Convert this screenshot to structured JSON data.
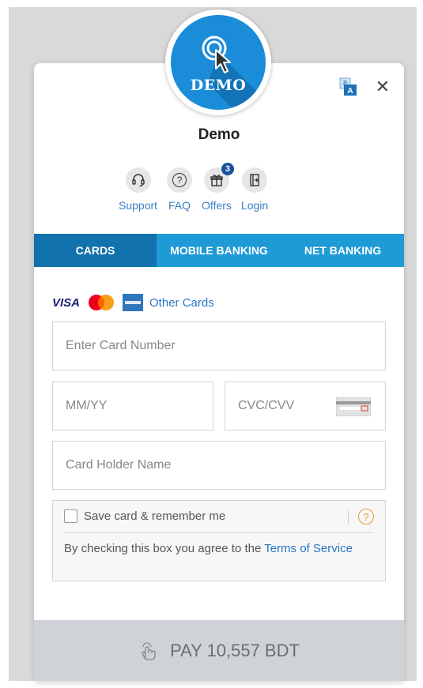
{
  "merchant": {
    "name": "Demo",
    "logo_text": "DEMO"
  },
  "header_icons": [
    "translate-icon",
    "close-icon"
  ],
  "close_glyph": "✕",
  "actions": [
    {
      "label": "Support",
      "icon": "headset-icon"
    },
    {
      "label": "FAQ",
      "icon": "question-icon",
      "glyph": "?"
    },
    {
      "label": "Offers",
      "icon": "gift-icon",
      "badge": "3"
    },
    {
      "label": "Login",
      "icon": "login-icon"
    }
  ],
  "tabs": [
    {
      "label": "CARDS",
      "active": true
    },
    {
      "label": "MOBILE BANKING",
      "active": false
    },
    {
      "label": "NET BANKING",
      "active": false
    }
  ],
  "card_brands": {
    "visa": "VISA",
    "other_cards": "Other Cards"
  },
  "fields": {
    "card_number_placeholder": "Enter Card Number",
    "expiry_placeholder": "MM/YY",
    "cvc_placeholder": "CVC/CVV",
    "holder_placeholder": "Card Holder Name"
  },
  "save_card": {
    "label": "Save card & remember me",
    "help_glyph": "?",
    "terms_prefix": "By checking this box you agree to the ",
    "terms_link": "Terms of Service"
  },
  "pay_button": {
    "label": "PAY 10,557 BDT"
  },
  "colors": {
    "accent": "#1e9ad6",
    "active_tab": "#1272ad",
    "link": "#2a78c2",
    "pay_bg": "#cfd3d8"
  }
}
